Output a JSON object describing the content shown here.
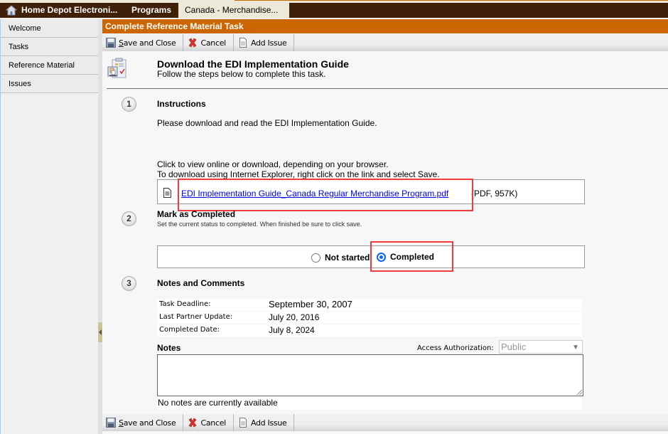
{
  "topnav": {
    "tabs": [
      {
        "label": "Home Depot Electroni...",
        "icon": "home-icon"
      },
      {
        "label": "Programs"
      },
      {
        "label": "Canada - Merchandise...",
        "active": true
      }
    ]
  },
  "sidebar": {
    "items": [
      {
        "label": "Welcome"
      },
      {
        "label": "Tasks"
      },
      {
        "label": "Reference Material"
      },
      {
        "label": "Issues"
      }
    ]
  },
  "page": {
    "title": "Complete Reference Material Task"
  },
  "toolbar": {
    "save_label": "ave and Close",
    "save_accel": "S",
    "cancel_label": "Cancel",
    "add_issue_label": "Add Issue"
  },
  "task": {
    "title": "Download the EDI Implementation Guide",
    "subtitle": "Follow the steps below to complete this task."
  },
  "steps": {
    "step1": {
      "number": "1",
      "title": "Instructions",
      "text": "Please download and read the EDI Implementation Guide.",
      "hint1": "Click to view online or download, depending on your browser.",
      "hint2": "To download using Internet Explorer, right click on the link and select Save.",
      "file_name": "EDI Implementation Guide_Canada Regular Merchandise Program.pdf",
      "file_meta": "(PDF, 957K)"
    },
    "step2": {
      "number": "2",
      "title": "Mark as Completed",
      "subtitle": "Set the current status to completed. When finished be sure to click save.",
      "options": [
        {
          "label": "Not started",
          "checked": false
        },
        {
          "label": "Completed",
          "checked": true
        }
      ]
    },
    "step3": {
      "number": "3",
      "title": "Notes and Comments",
      "rows": [
        {
          "label": "Task Deadline:",
          "value": "September 30, 2007"
        },
        {
          "label": "Last Partner Update:",
          "value": "July 20, 2016"
        },
        {
          "label": "Completed Date:",
          "value": "July 8, 2024"
        }
      ],
      "notes_label": "Notes",
      "access_label": "Access Authorization:",
      "access_value": "Public",
      "notes_value": "",
      "no_notes_text": "No notes are currently available"
    }
  },
  "colors": {
    "topbar": "#41200a",
    "titlebar": "#cc6600",
    "highlight": "#ef3b3b",
    "link": "#0000ee",
    "radio_checked": "#0a66ff"
  }
}
